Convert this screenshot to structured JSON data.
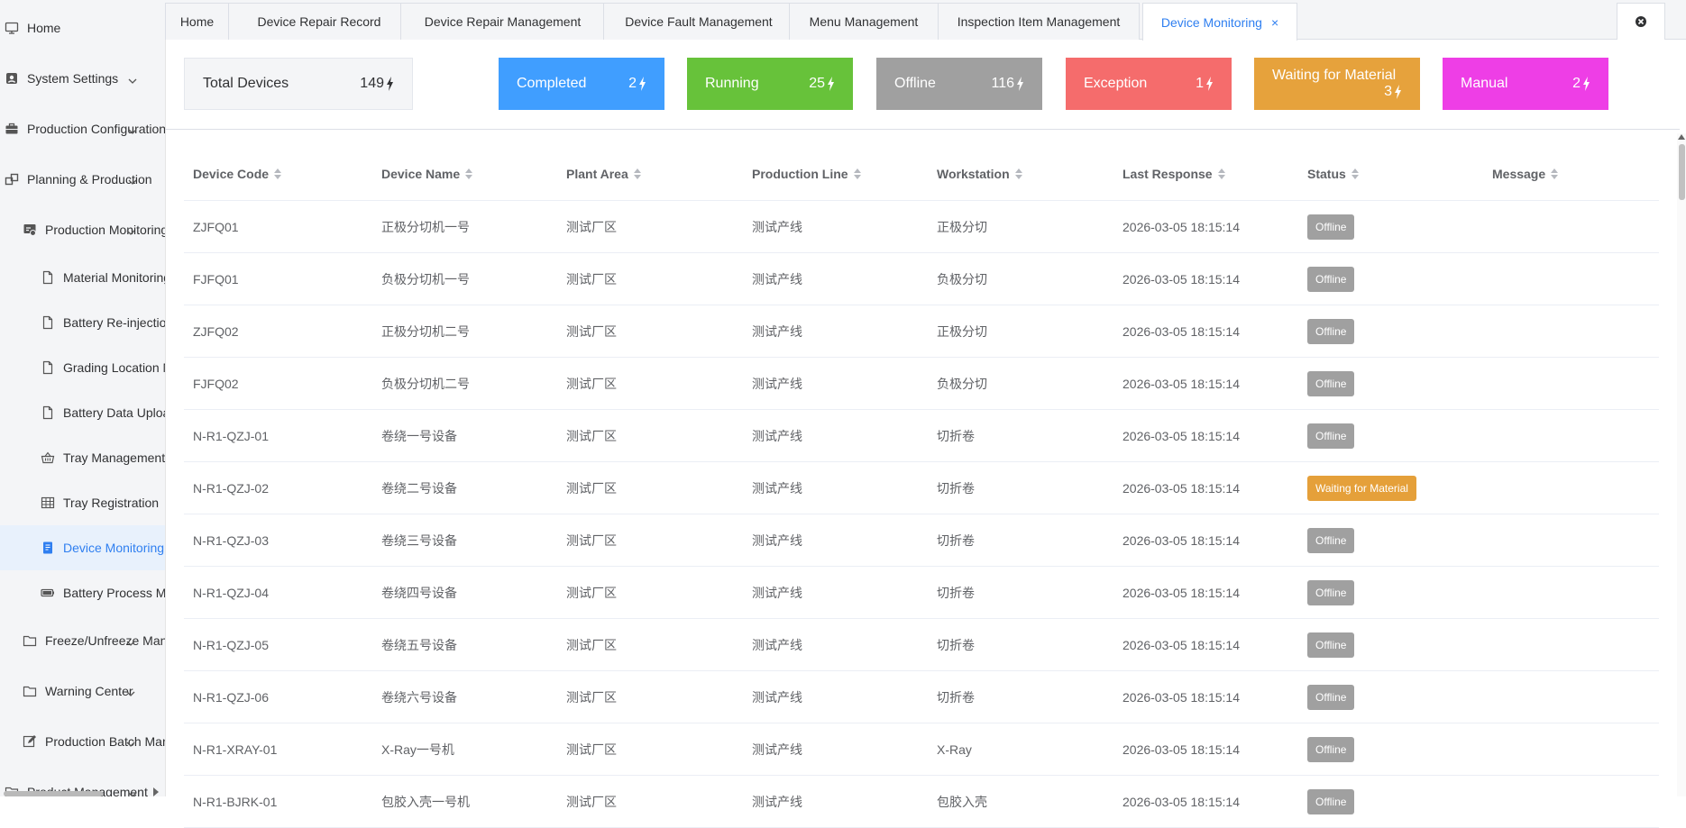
{
  "sidebar": {
    "items": [
      {
        "label": "Home",
        "icon": "monitor-icon",
        "has_arrow": false
      },
      {
        "label": "System Settings",
        "icon": "settings-icon",
        "has_arrow": true
      },
      {
        "label": "Production Configuration",
        "icon": "briefcase-icon",
        "has_arrow": true
      },
      {
        "label": "Planning & Production",
        "icon": "squares-icon",
        "has_arrow": true
      },
      {
        "label": "Production Monitoring",
        "icon": "screen-icon",
        "has_arrow": true
      },
      {
        "label": "Material Monitoring",
        "icon": "document-icon",
        "has_arrow": false
      },
      {
        "label": "Battery Re-injection",
        "icon": "document-icon",
        "has_arrow": false
      },
      {
        "label": "Grading Location M",
        "icon": "document-icon",
        "has_arrow": false
      },
      {
        "label": "Battery Data Upload",
        "icon": "document-icon",
        "has_arrow": false
      },
      {
        "label": "Tray Management",
        "icon": "basket-icon",
        "has_arrow": false
      },
      {
        "label": "Tray Registration",
        "icon": "grid-icon",
        "has_arrow": false
      },
      {
        "label": "Device Monitoring",
        "icon": "book-icon",
        "has_arrow": false
      },
      {
        "label": "Battery Process M",
        "icon": "battery-icon",
        "has_arrow": false
      },
      {
        "label": "Freeze/Unfreeze Man",
        "icon": "folder-icon",
        "has_arrow": true
      },
      {
        "label": "Warning Center",
        "icon": "folder-icon",
        "has_arrow": true
      },
      {
        "label": "Production Batch Man",
        "icon": "edit-icon",
        "has_arrow": true
      },
      {
        "label": "Product Management",
        "icon": "folder-icon",
        "has_arrow": true
      }
    ]
  },
  "tabs": [
    {
      "label": "Home"
    },
    {
      "label": "Device Repair Record"
    },
    {
      "label": "Device Repair Management"
    },
    {
      "label": "Device Fault Management"
    },
    {
      "label": "Menu Management"
    },
    {
      "label": "Inspection Item Management"
    },
    {
      "label": "Device Monitoring",
      "close": "×"
    }
  ],
  "stats": {
    "total": {
      "label": "Total Devices",
      "value": "149"
    },
    "completed": {
      "label": "Completed",
      "value": "2",
      "color": "#409eff"
    },
    "running": {
      "label": "Running",
      "value": "25",
      "color": "#67c23a"
    },
    "offline": {
      "label": "Offline",
      "value": "116",
      "color": "#a0a0a0"
    },
    "exception": {
      "label": "Exception",
      "value": "1",
      "color": "#f56c6c"
    },
    "waiting": {
      "label": "Waiting for Material",
      "value": "3",
      "color": "#e6a23c"
    },
    "manual": {
      "label": "Manual",
      "value": "2",
      "color": "#ee3ee6"
    }
  },
  "table": {
    "headers": [
      "Device Code",
      "Device Name",
      "Plant Area",
      "Production Line",
      "Workstation",
      "Last Response",
      "Status",
      "Message"
    ],
    "rows": [
      {
        "code": "ZJFQ01",
        "name": "正极分切机一号",
        "area": "测试厂区",
        "line": "测试产线",
        "station": "正极分切",
        "last": "2026-03-05 18:15:14",
        "status": "Offline",
        "message": ""
      },
      {
        "code": "FJFQ01",
        "name": "负极分切机一号",
        "area": "测试厂区",
        "line": "测试产线",
        "station": "负极分切",
        "last": "2026-03-05 18:15:14",
        "status": "Offline",
        "message": ""
      },
      {
        "code": "ZJFQ02",
        "name": "正极分切机二号",
        "area": "测试厂区",
        "line": "测试产线",
        "station": "正极分切",
        "last": "2026-03-05 18:15:14",
        "status": "Offline",
        "message": ""
      },
      {
        "code": "FJFQ02",
        "name": "负极分切机二号",
        "area": "测试厂区",
        "line": "测试产线",
        "station": "负极分切",
        "last": "2026-03-05 18:15:14",
        "status": "Offline",
        "message": ""
      },
      {
        "code": "N-R1-QZJ-01",
        "name": "卷绕一号设备",
        "area": "测试厂区",
        "line": "测试产线",
        "station": "切折卷",
        "last": "2026-03-05 18:15:14",
        "status": "Offline",
        "message": ""
      },
      {
        "code": "N-R1-QZJ-02",
        "name": "卷绕二号设备",
        "area": "测试厂区",
        "line": "测试产线",
        "station": "切折卷",
        "last": "2026-03-05 18:15:14",
        "status": "Waiting for Material",
        "message": ""
      },
      {
        "code": "N-R1-QZJ-03",
        "name": "卷绕三号设备",
        "area": "测试厂区",
        "line": "测试产线",
        "station": "切折卷",
        "last": "2026-03-05 18:15:14",
        "status": "Offline",
        "message": ""
      },
      {
        "code": "N-R1-QZJ-04",
        "name": "卷绕四号设备",
        "area": "测试厂区",
        "line": "测试产线",
        "station": "切折卷",
        "last": "2026-03-05 18:15:14",
        "status": "Offline",
        "message": ""
      },
      {
        "code": "N-R1-QZJ-05",
        "name": "卷绕五号设备",
        "area": "测试厂区",
        "line": "测试产线",
        "station": "切折卷",
        "last": "2026-03-05 18:15:14",
        "status": "Offline",
        "message": ""
      },
      {
        "code": "N-R1-QZJ-06",
        "name": "卷绕六号设备",
        "area": "测试厂区",
        "line": "测试产线",
        "station": "切折卷",
        "last": "2026-03-05 18:15:14",
        "status": "Offline",
        "message": ""
      },
      {
        "code": "N-R1-XRAY-01",
        "name": "X-Ray一号机",
        "area": "测试厂区",
        "line": "测试产线",
        "station": "X-Ray",
        "last": "2026-03-05 18:15:14",
        "status": "Offline",
        "message": ""
      },
      {
        "code": "N-R1-BJRK-01",
        "name": "包胶入壳一号机",
        "area": "测试厂区",
        "line": "测试产线",
        "station": "包胶入壳",
        "last": "2026-03-05 18:15:14",
        "status": "Offline",
        "message": ""
      }
    ]
  }
}
